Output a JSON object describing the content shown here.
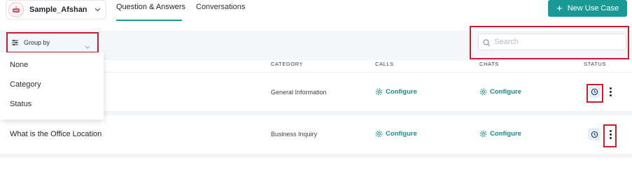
{
  "header": {
    "app_name": "Sample_Afshan",
    "tabs": [
      {
        "label": "Question & Answers",
        "active": true
      },
      {
        "label": "Conversations",
        "active": false
      }
    ],
    "new_button_label": "New Use Case"
  },
  "toolbar": {
    "group_by_label": "Group by",
    "search_placeholder": "Search"
  },
  "group_by_menu": {
    "options": [
      "None",
      "Category",
      "Status"
    ]
  },
  "table": {
    "columns": [
      "CATEGORY",
      "CALLS",
      "CHATS",
      "STATUS"
    ],
    "rows": [
      {
        "question": "",
        "category": "General Information",
        "calls": "Configure",
        "chats": "Configure"
      },
      {
        "question": "What is the Office Location",
        "category": "Business Inquiry",
        "calls": "Configure",
        "chats": "Configure"
      }
    ]
  },
  "colors": {
    "accent": "#1a9a96",
    "highlight": "#c61f2b",
    "toolbar_bg": "#f3f7fa"
  },
  "icons": [
    "app-logo-icon",
    "chevron-down-icon",
    "plus-icon",
    "filter-icon",
    "search-icon",
    "gear-icon",
    "clock-icon",
    "kebab-icon"
  ]
}
